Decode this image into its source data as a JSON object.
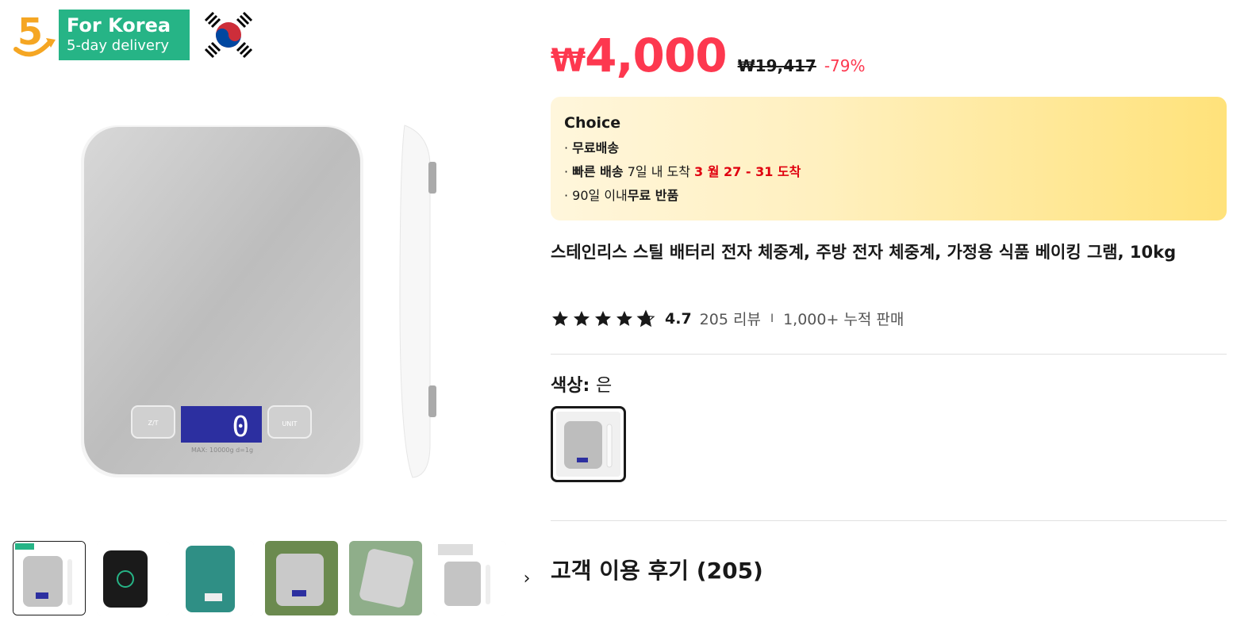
{
  "badge": {
    "number": "5",
    "title": "For Korea",
    "subtitle": "5-day delivery"
  },
  "thumbnails": [
    "thumb-1",
    "thumb-2",
    "thumb-3",
    "thumb-4",
    "thumb-5",
    "thumb-6"
  ],
  "thumb_next": "›",
  "price": {
    "currency": "₩",
    "current": "4,000",
    "original": "₩19,417",
    "discount": "-79%"
  },
  "choice": {
    "title": "Choice",
    "free_shipping": "무료배송",
    "fast_label": "빠른 배송",
    "fast_text": " 7일 내 도착 ",
    "fast_date": "3 월 27 - 31 도착",
    "return_prefix": "90일 이내",
    "return_bold": "무료 반품"
  },
  "product": {
    "title": "스테인리스 스틸 배터리 전자 체중계, 주방 전자 체중계, 가정용 식품 베이킹 그램, 10kg"
  },
  "rating": {
    "value": "4.7",
    "stars": 4.7,
    "reviews": "205 리뷰",
    "separator": "I",
    "sold": "1,000+ 누적 판매"
  },
  "color": {
    "label": "색상: ",
    "value": "은"
  },
  "reviews_section": {
    "title": "고객 이용 후기 (205)"
  },
  "colors": {
    "price_red": "#fd384f",
    "badge_green": "#26b486",
    "choice_yellow": "#ffe27a"
  }
}
